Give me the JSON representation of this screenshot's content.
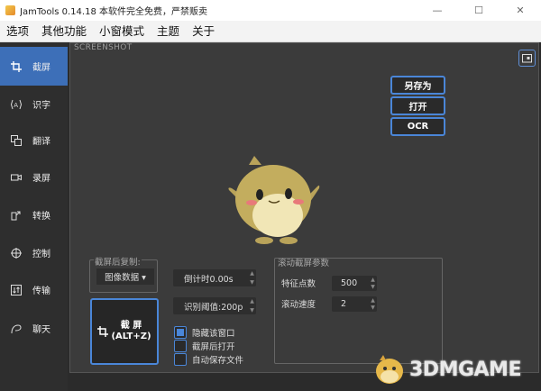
{
  "window": {
    "title": "JamTools 0.14.18 本软件完全免费，严禁贩卖",
    "minimize": "—",
    "maximize": "☐",
    "close": "✕"
  },
  "menu": [
    "选项",
    "其他功能",
    "小窗模式",
    "主题",
    "关于"
  ],
  "sidebar": {
    "items": [
      {
        "label": "截屏",
        "icon": "crop-icon",
        "active": true
      },
      {
        "label": "识字",
        "icon": "text-recognition-icon",
        "active": false
      },
      {
        "label": "翻译",
        "icon": "translate-icon",
        "active": false
      },
      {
        "label": "录屏",
        "icon": "video-camera-icon",
        "active": false
      },
      {
        "label": "转换",
        "icon": "convert-icon",
        "active": false
      },
      {
        "label": "控制",
        "icon": "crosshair-icon",
        "active": false
      },
      {
        "label": "传输",
        "icon": "transfer-icon",
        "active": false
      },
      {
        "label": "聊天",
        "icon": "chat-icon",
        "active": false
      }
    ]
  },
  "main": {
    "screenshot_label": "SCREENSHOT",
    "buttons": {
      "save_as": "另存为",
      "open": "打开",
      "ocr": "OCR"
    },
    "copy_group": {
      "label": "截屏后复制:",
      "selected": "图像数据 ▾"
    },
    "big_shot": {
      "line1": "截 屏",
      "line2": "(ALT+Z)"
    },
    "countdown": "倒计时0.00s",
    "threshold": "识别阈值:200p",
    "checks": [
      {
        "label": "隐藏该窗口",
        "checked": true
      },
      {
        "label": "截屏后打开",
        "checked": false
      },
      {
        "label": "自动保存文件",
        "checked": false
      }
    ],
    "scroll_group": {
      "label": "滚动截屏参数",
      "feature_label": "特征点数",
      "feature_value": "500",
      "speed_label": "滚动速度",
      "speed_value": "2"
    }
  },
  "watermark": {
    "text": "3DMGAME"
  },
  "colors": {
    "accent": "#4a86d8",
    "active_tab": "#3d6fb8"
  }
}
